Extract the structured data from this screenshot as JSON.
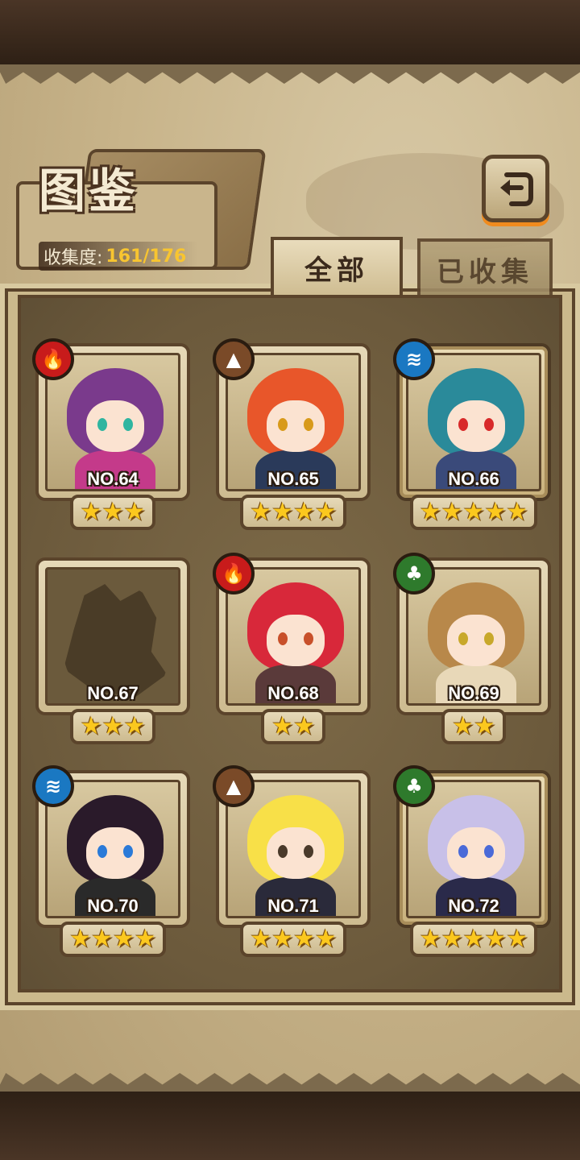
{
  "header": {
    "title": "图鉴",
    "collection_label": "收集度:",
    "collection_value": "161/176",
    "back_icon": "back-arrow-icon"
  },
  "tabs": [
    {
      "label": "全部",
      "active": true
    },
    {
      "label": "已收集",
      "active": false
    }
  ],
  "cards": [
    {
      "label": "NO.64",
      "stars": "★★★",
      "element": "fire",
      "element_glyph": "🔥",
      "hair": "#7a3a8c",
      "body": "#c43a8a",
      "eye": "#2fb5a0",
      "locked": false,
      "gold": false
    },
    {
      "label": "NO.65",
      "stars": "★★★★",
      "element": "earth",
      "element_glyph": "▲",
      "hair": "#e8562a",
      "body": "#2a3a5a",
      "eye": "#d89a1a",
      "locked": false,
      "gold": false
    },
    {
      "label": "NO.66",
      "stars": "★★★★★",
      "element": "water",
      "element_glyph": "≋",
      "hair": "#2a8a9a",
      "body": "#3a4a7a",
      "eye": "#d82a2a",
      "locked": false,
      "gold": true
    },
    {
      "label": "NO.67",
      "stars": "★★★",
      "element": "",
      "element_glyph": "",
      "hair": "",
      "body": "",
      "eye": "",
      "locked": true,
      "gold": false
    },
    {
      "label": "NO.68",
      "stars": "★★",
      "element": "fire",
      "element_glyph": "🔥",
      "hair": "#d8283a",
      "body": "#5a3a3a",
      "eye": "#c8502a",
      "locked": false,
      "gold": false
    },
    {
      "label": "NO.69",
      "stars": "★★",
      "element": "wood",
      "element_glyph": "♣",
      "hair": "#b8884a",
      "body": "#e8d8b8",
      "eye": "#c8a82a",
      "locked": false,
      "gold": false
    },
    {
      "label": "NO.70",
      "stars": "★★★★",
      "element": "water",
      "element_glyph": "≋",
      "hair": "#2a1a2a",
      "body": "#2a2a2a",
      "eye": "#2a7ad8",
      "locked": false,
      "gold": false
    },
    {
      "label": "NO.71",
      "stars": "★★★★",
      "element": "earth",
      "element_glyph": "▲",
      "hair": "#f8e048",
      "body": "#2a2a3a",
      "eye": "#4a3a2a",
      "locked": false,
      "gold": false
    },
    {
      "label": "NO.72",
      "stars": "★★★★★",
      "element": "wood",
      "element_glyph": "♣",
      "hair": "#c8c0e8",
      "body": "#2a2a4a",
      "eye": "#4a6ad8",
      "locked": false,
      "gold": true
    }
  ]
}
